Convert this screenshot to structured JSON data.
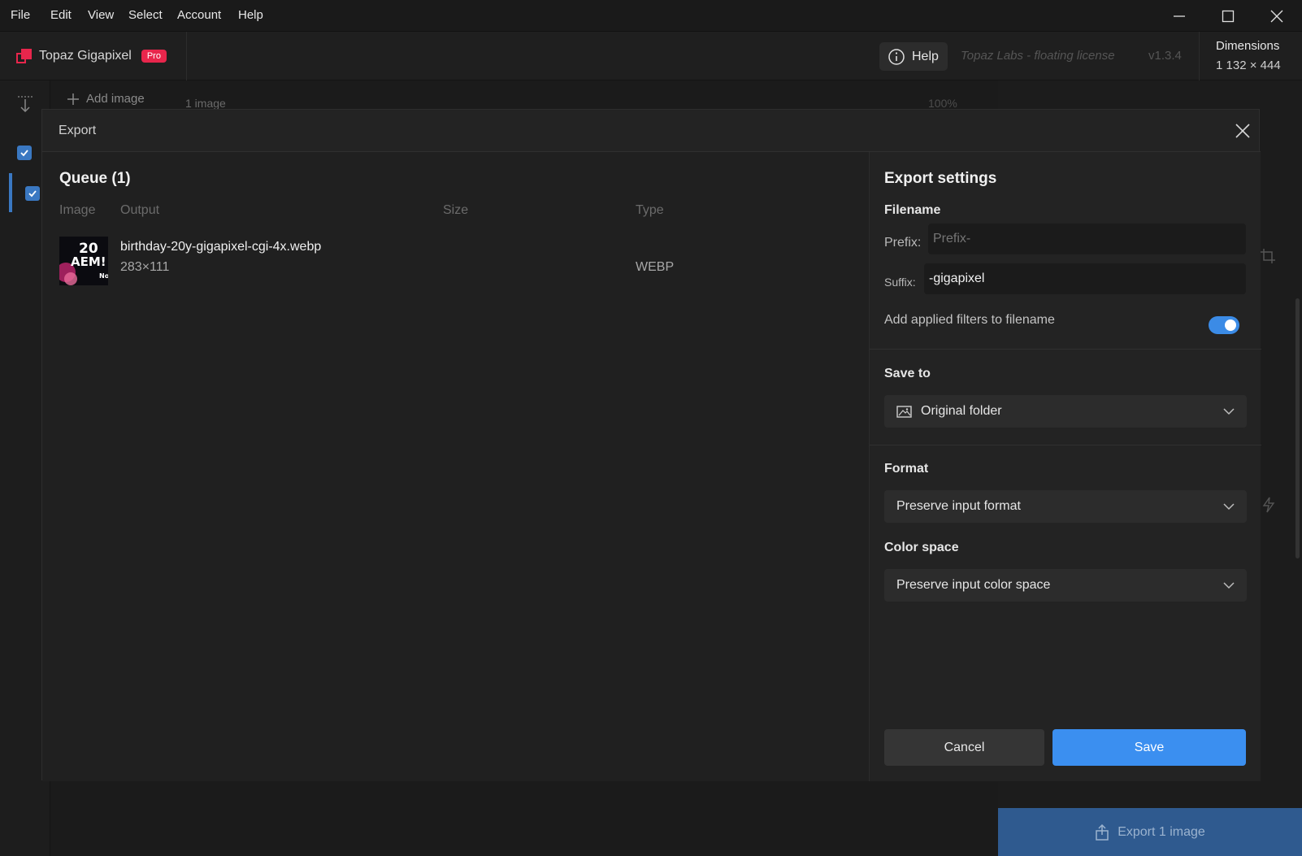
{
  "menubar": {
    "items": [
      "File",
      "Edit",
      "View",
      "Select",
      "Account",
      "Help"
    ]
  },
  "header": {
    "app_name": "Topaz Gigapixel",
    "tier_badge": "Pro",
    "help_label": "Help",
    "license": "Topaz Labs - floating license",
    "version": "v1.3.4",
    "dimensions_label": "Dimensions",
    "dimensions_value": "1 132 × 444"
  },
  "background": {
    "add_image_label": "Add image",
    "image_count": "1 image",
    "zoom": "100%",
    "export_button": "Export 1 image"
  },
  "dialog": {
    "title": "Export",
    "queue": {
      "title": "Queue (1)",
      "columns": [
        "Image",
        "Output",
        "Size",
        "Type"
      ],
      "items": [
        {
          "thumbnail_text": "20 AEM! No",
          "output": "birthday-20y-gigapixel-cgi-4x.webp",
          "dimensions": "283×111",
          "size": "",
          "type": "WEBP"
        }
      ]
    },
    "settings": {
      "title": "Export settings",
      "filename_label": "Filename",
      "prefix_label": "Prefix:",
      "prefix_placeholder": "Prefix-",
      "prefix_value": "",
      "suffix_label": "Suffix:",
      "suffix_value": "-gigapixel",
      "filters_label": "Add applied filters to filename",
      "filters_enabled": true,
      "save_to_label": "Save to",
      "save_to_value": "Original folder",
      "format_label": "Format",
      "format_value": "Preserve input format",
      "color_space_label": "Color space",
      "color_space_value": "Preserve input color space",
      "cancel_label": "Cancel",
      "save_label": "Save"
    }
  },
  "colors": {
    "accent": "#3b8ff0",
    "brand": "#e8264c",
    "toggle_on": "#3b8be6"
  }
}
